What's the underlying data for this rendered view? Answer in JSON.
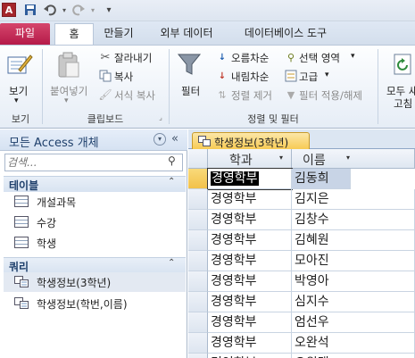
{
  "qat": {
    "app_letter": "A"
  },
  "tabs": [
    {
      "label": "파일"
    },
    {
      "label": "홈"
    },
    {
      "label": "만들기"
    },
    {
      "label": "외부 데이터"
    },
    {
      "label": "데이터베이스 도구"
    }
  ],
  "ribbon": {
    "view": {
      "label": "보기",
      "group": "보기"
    },
    "clipboard": {
      "paste": "붙여넣기",
      "cut": "잘라내기",
      "copy": "복사",
      "format_copy": "서식 복사",
      "group": "클립보드"
    },
    "sort_filter": {
      "filter": "필터",
      "ascending": "오름차순",
      "descending": "내림차순",
      "remove_sort": "정렬 제거",
      "selection": "선택 영역",
      "advanced": "고급",
      "toggle_filter": "필터 적용/해제",
      "group": "정렬 및 필터"
    },
    "records": {
      "refresh": "모두 새",
      "refresh2": "고침"
    }
  },
  "nav": {
    "title": "모든 Access 개체",
    "search_placeholder": "검색...",
    "categories": [
      {
        "label": "테이블",
        "items": [
          "개설과목",
          "수강",
          "학생"
        ]
      },
      {
        "label": "쿼리",
        "items": [
          "학생정보(3학년)",
          "학생정보(학번,이름)"
        ]
      }
    ]
  },
  "document": {
    "tab_title": "학생정보(3학년)",
    "columns": [
      "학과",
      "이름"
    ],
    "rows": [
      [
        "경영학부",
        "김동희"
      ],
      [
        "경영학부",
        "김지은"
      ],
      [
        "경영학부",
        "김창수"
      ],
      [
        "경영학부",
        "김혜원"
      ],
      [
        "경영학부",
        "모아진"
      ],
      [
        "경영학부",
        "박영아"
      ],
      [
        "경영학부",
        "심지수"
      ],
      [
        "경영학부",
        "엄선우"
      ],
      [
        "경영학부",
        "오완석"
      ],
      [
        "경영학부",
        "오원택"
      ]
    ]
  },
  "colors": {
    "file_tab": "#c02a57",
    "doc_tab": "#f7c950",
    "accent": "#1e3f6b",
    "selected_cell": "#000000"
  }
}
